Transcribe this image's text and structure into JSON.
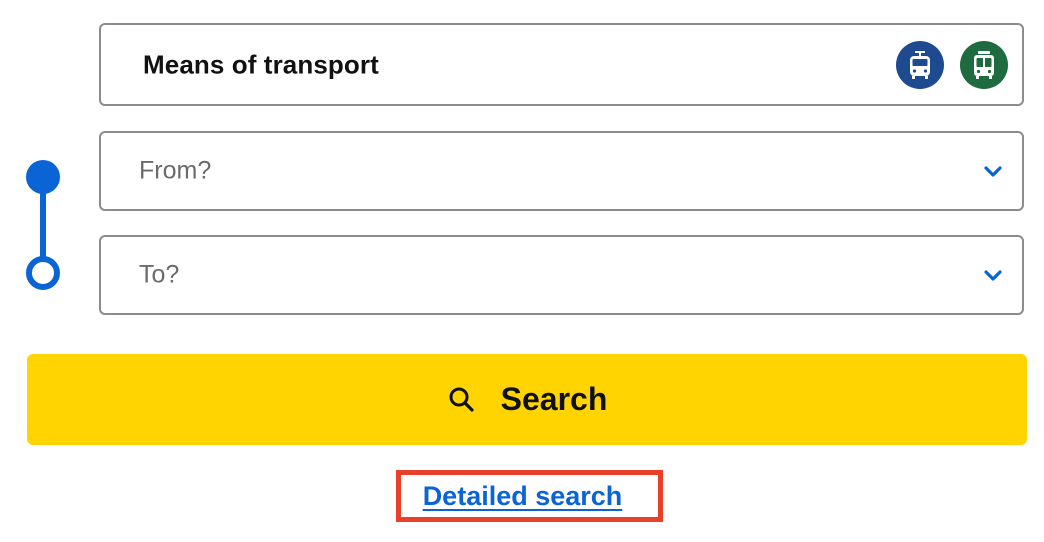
{
  "transport": {
    "label": "Means of transport",
    "modes": [
      {
        "name": "tram",
        "icon": "tram-icon",
        "color": "#1e4a8f"
      },
      {
        "name": "bus",
        "icon": "bus-icon",
        "color": "#1d6b3e"
      }
    ]
  },
  "from": {
    "placeholder": "From?",
    "value": ""
  },
  "to": {
    "placeholder": "To?",
    "value": ""
  },
  "route": {
    "color": "#0a64d6"
  },
  "search": {
    "label": "Search",
    "color": "#ffd400"
  },
  "detailed_search": {
    "label": "Detailed search",
    "highlight_color": "#e8402a"
  }
}
